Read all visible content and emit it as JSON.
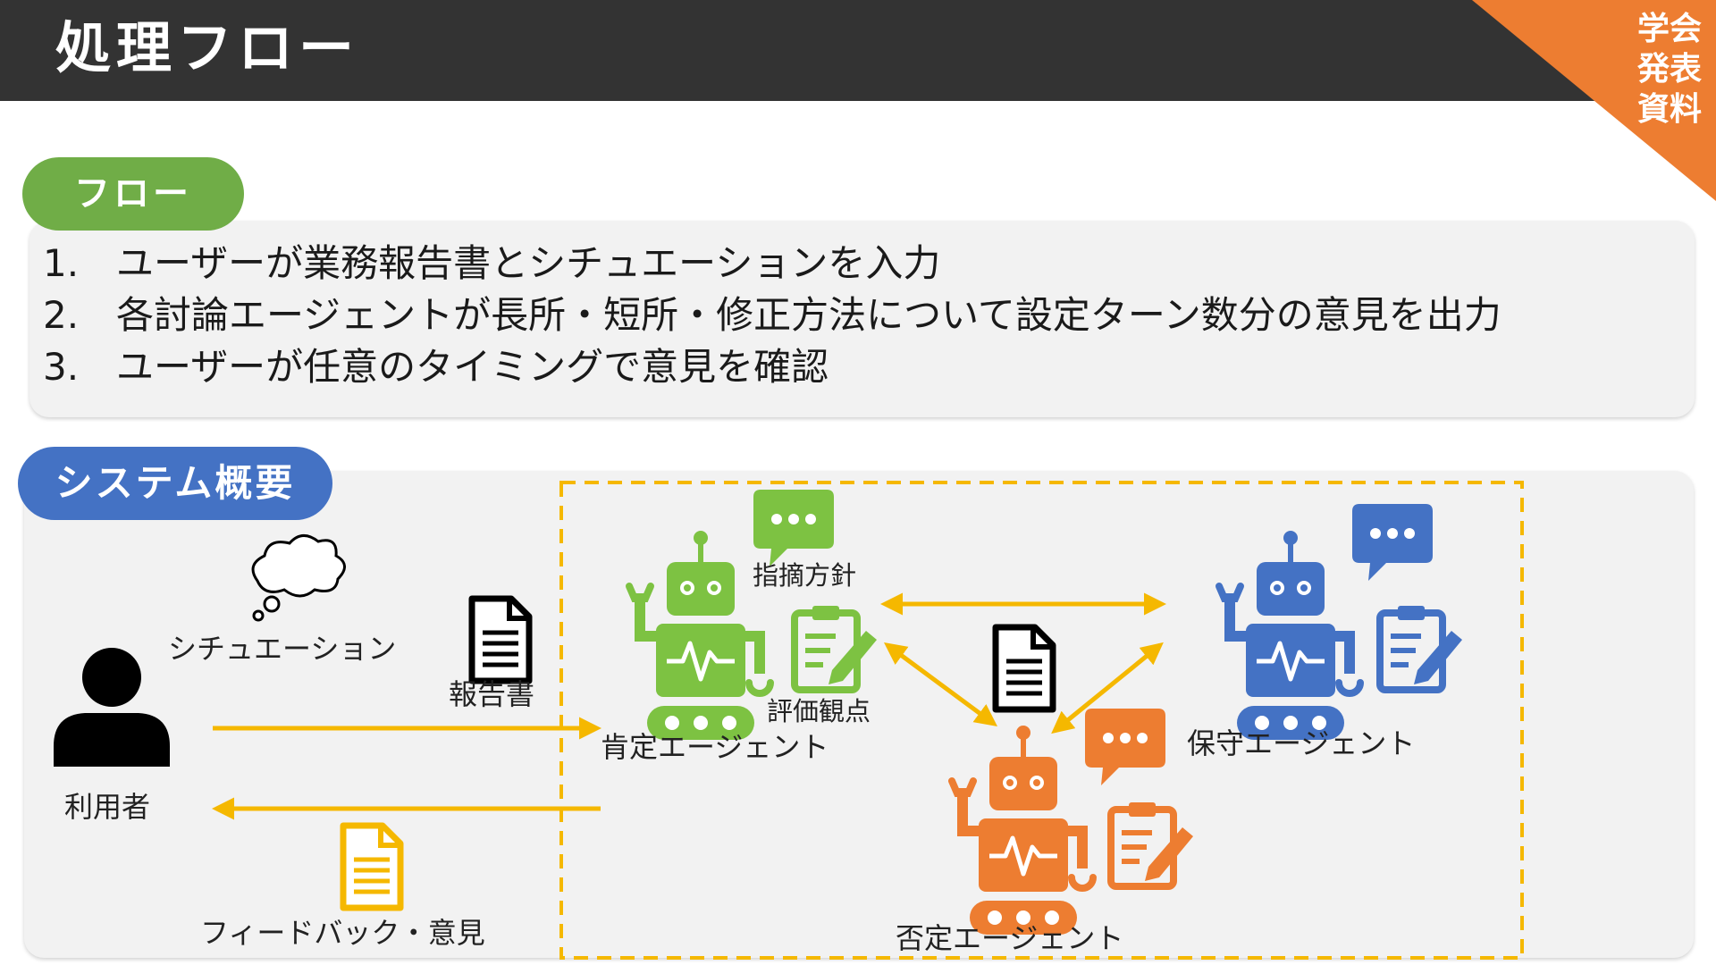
{
  "header": {
    "title": "処理フロー",
    "corner_badge": "学会発表資料",
    "corner_color": "#ed7d31"
  },
  "flow": {
    "pill_label": "フロー",
    "pill_color": "#70ad47",
    "items": [
      {
        "num": "1.",
        "text": "ユーザーが業務報告書とシチュエーションを入力"
      },
      {
        "num": "2.",
        "text": "各討論エージェントが長所・短所・修正方法について設定ターン数分の意見を出力"
      },
      {
        "num": "3.",
        "text": "ユーザーが任意のタイミングで意見を確認"
      }
    ]
  },
  "system": {
    "pill_label": "システム概要",
    "pill_color": "#4472c4",
    "labels": {
      "user": "利用者",
      "situation": "シチュエーション",
      "report_left": "報告書",
      "feedback": "フィードバック・意見",
      "policy": "指摘方針",
      "criteria": "評価観点",
      "affirmative": "肯定エージェント",
      "conservative": "保守エージェント",
      "negative": "否定エージェント"
    },
    "colors": {
      "affirmative": "#7dc242",
      "conservative": "#4472c4",
      "negative": "#ed7d31",
      "arrow": "#f5b800",
      "feedback_doc": "#f5b800"
    },
    "icons": [
      "person-icon",
      "thought-bubble-icon",
      "document-icon",
      "robot-icon",
      "speech-bubble-icon",
      "clipboard-icon"
    ]
  }
}
